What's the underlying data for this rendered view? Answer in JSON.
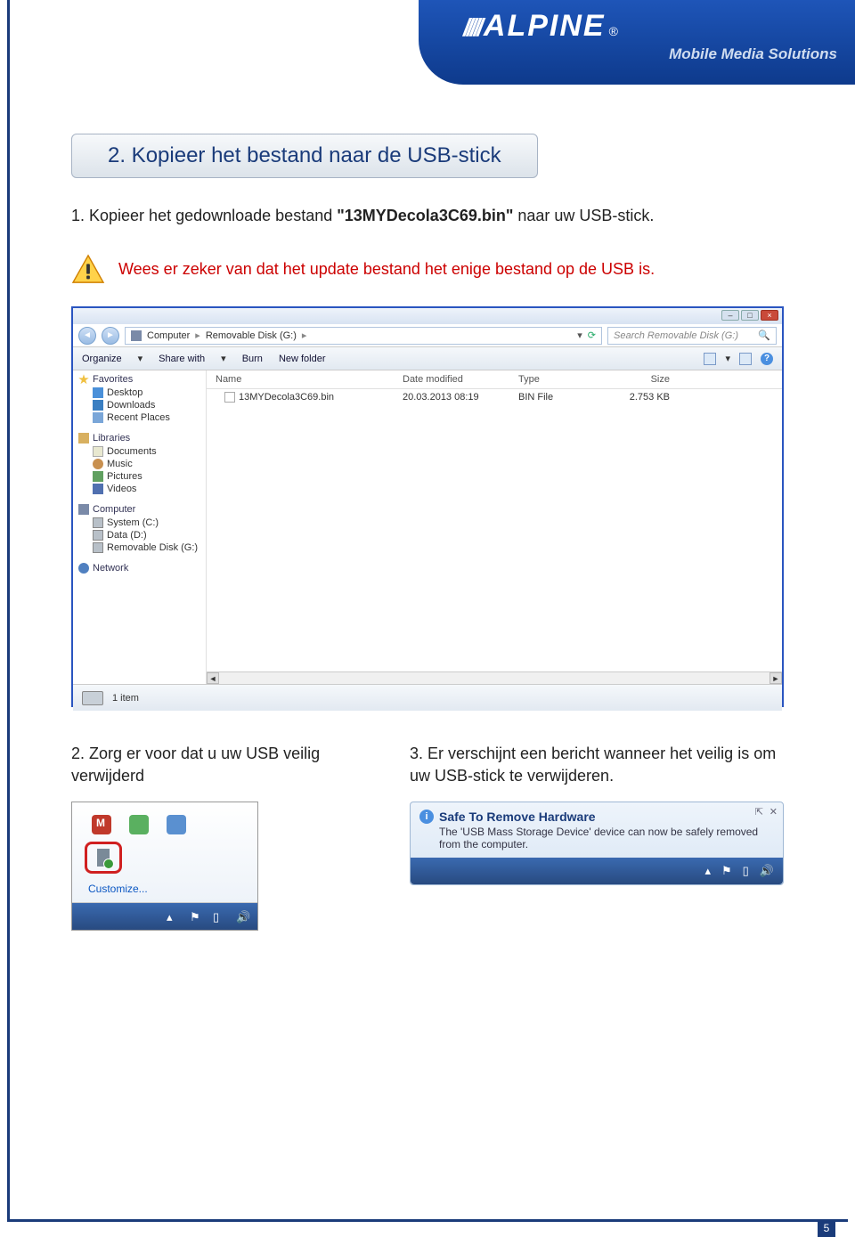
{
  "brand": {
    "name": "ALPINE",
    "tagline": "Mobile Media Solutions"
  },
  "section_title": "2. Kopieer het bestand naar de USB-stick",
  "step1_prefix": "1. Kopieer het gedownloade bestand ",
  "step1_filename": "\"13MYDecola3C69.bin\"",
  "step1_suffix": "  naar uw USB-stick.",
  "warning": "Wees er zeker van dat het update bestand het enige bestand op de USB is.",
  "explorer": {
    "breadcrumb": {
      "root": "Computer",
      "folder": "Removable Disk (G:)"
    },
    "search_placeholder": "Search Removable Disk (G:)",
    "toolbar": {
      "organize": "Organize",
      "share": "Share with",
      "burn": "Burn",
      "newfolder": "New folder"
    },
    "columns": {
      "name": "Name",
      "date": "Date modified",
      "type": "Type",
      "size": "Size"
    },
    "tree": {
      "favorites": "Favorites",
      "desktop": "Desktop",
      "downloads": "Downloads",
      "recent": "Recent Places",
      "libraries": "Libraries",
      "documents": "Documents",
      "music": "Music",
      "pictures": "Pictures",
      "videos": "Videos",
      "computer": "Computer",
      "systemc": "System (C:)",
      "datad": "Data (D:)",
      "remg": "Removable Disk (G:)",
      "network": "Network"
    },
    "file": {
      "name": "13MYDecola3C69.bin",
      "date": "20.03.2013 08:19",
      "type": "BIN File",
      "size": "2.753 KB"
    },
    "status": "1 item"
  },
  "step2": "2. Zorg er voor dat u uw USB veilig verwijderd",
  "step3": "3. Er verschijnt een bericht wanneer het veilig is om uw USB-stick te verwijderen.",
  "tray": {
    "customize": "Customize..."
  },
  "balloon": {
    "title": "Safe To Remove Hardware",
    "body": "The 'USB Mass Storage Device' device can now be safely removed from the computer."
  },
  "page_number": "5"
}
